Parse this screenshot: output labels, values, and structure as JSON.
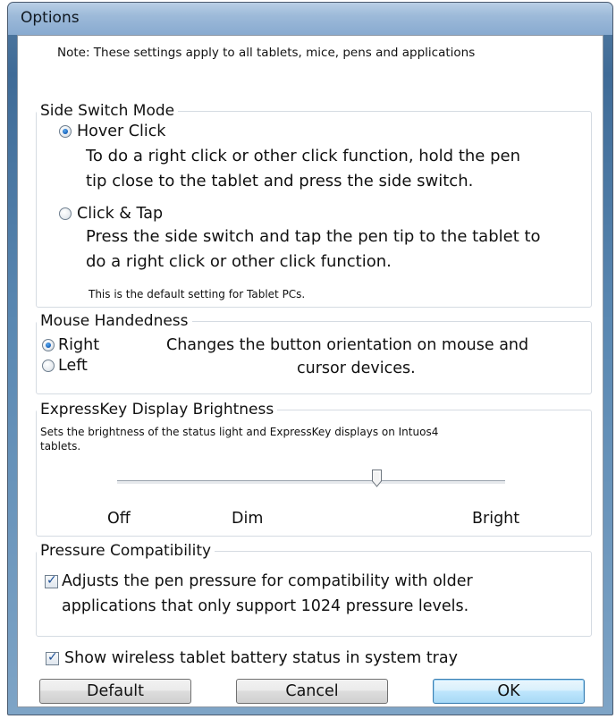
{
  "window": {
    "title": "Options"
  },
  "note": "Note: These settings apply to all tablets, mice, pens and applications",
  "side_switch": {
    "title": "Side Switch Mode",
    "option1_label": "Hover Click",
    "option1_desc_line1": "To do a right click or other click function, hold the pen",
    "option1_desc_line2": "tip close to the tablet and press the side switch.",
    "option2_label": "Click & Tap",
    "option2_desc_line1": "Press the side switch and tap the pen tip to the tablet to",
    "option2_desc_line2": "do a right click or other click function.",
    "default_note": "This is the default setting for Tablet PCs.",
    "selected": "Hover Click"
  },
  "mouse_handedness": {
    "title": "Mouse Handedness",
    "right_label": "Right",
    "left_label": "Left",
    "desc_line1": "Changes the button orientation on mouse and",
    "desc_line2": "cursor devices.",
    "selected": "Right"
  },
  "brightness": {
    "title": "ExpressKey Display Brightness",
    "desc_line1": "Sets the brightness of the status light and ExpressKey displays on Intuos4",
    "desc_line2": "tablets.",
    "label_off": "Off",
    "label_dim": "Dim",
    "label_bright": "Bright",
    "slider_level": 0.67
  },
  "pressure": {
    "title": "Pressure Compatibility",
    "desc_line1": "Adjusts the pen pressure for compatibility with older",
    "desc_line2": "applications that only support 1024 pressure levels.",
    "checked": true
  },
  "battery": {
    "label": "Show wireless tablet battery status in system tray",
    "checked": true
  },
  "buttons": {
    "default_label": "Default",
    "cancel_label": "Cancel",
    "ok_label": "OK"
  }
}
